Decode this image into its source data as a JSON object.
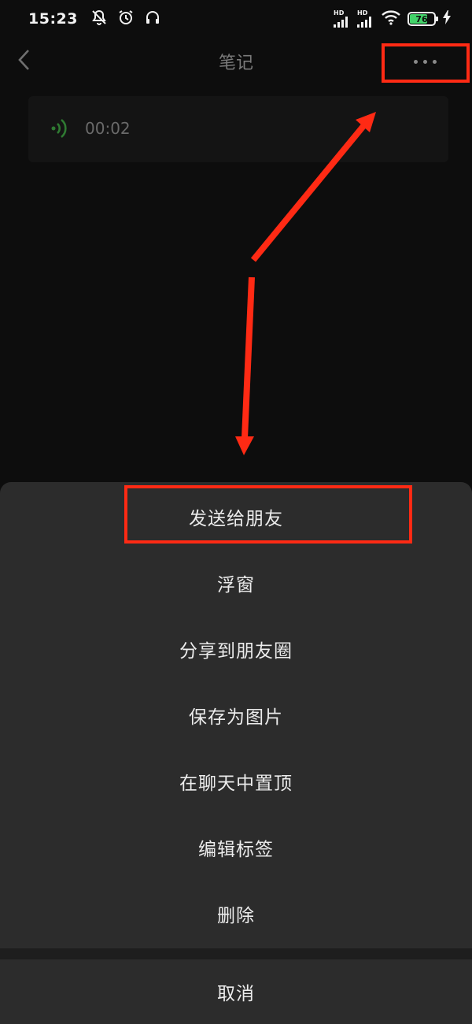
{
  "status_bar": {
    "time": "15:23",
    "icons": [
      "mute-icon",
      "alarm-icon",
      "headset-icon"
    ],
    "signal_label_1": "HD",
    "signal_label_2": "HD",
    "battery_level": "76",
    "battery_color": "#43d36a"
  },
  "nav": {
    "title": "笔记",
    "back_icon": "chevron-left-icon",
    "more_icon": "more-dots-icon"
  },
  "voice_note": {
    "duration": "00:02",
    "icon": "voice-wave-icon",
    "icon_color": "#2f7a32"
  },
  "menu": {
    "items": [
      {
        "label": "发送给朋友"
      },
      {
        "label": "浮窗"
      },
      {
        "label": "分享到朋友圈"
      },
      {
        "label": "保存为图片"
      },
      {
        "label": "在聊天中置顶"
      },
      {
        "label": "编辑标签"
      },
      {
        "label": "删除"
      }
    ],
    "cancel_label": "取消"
  },
  "annotations": {
    "color": "#ff2a14"
  }
}
